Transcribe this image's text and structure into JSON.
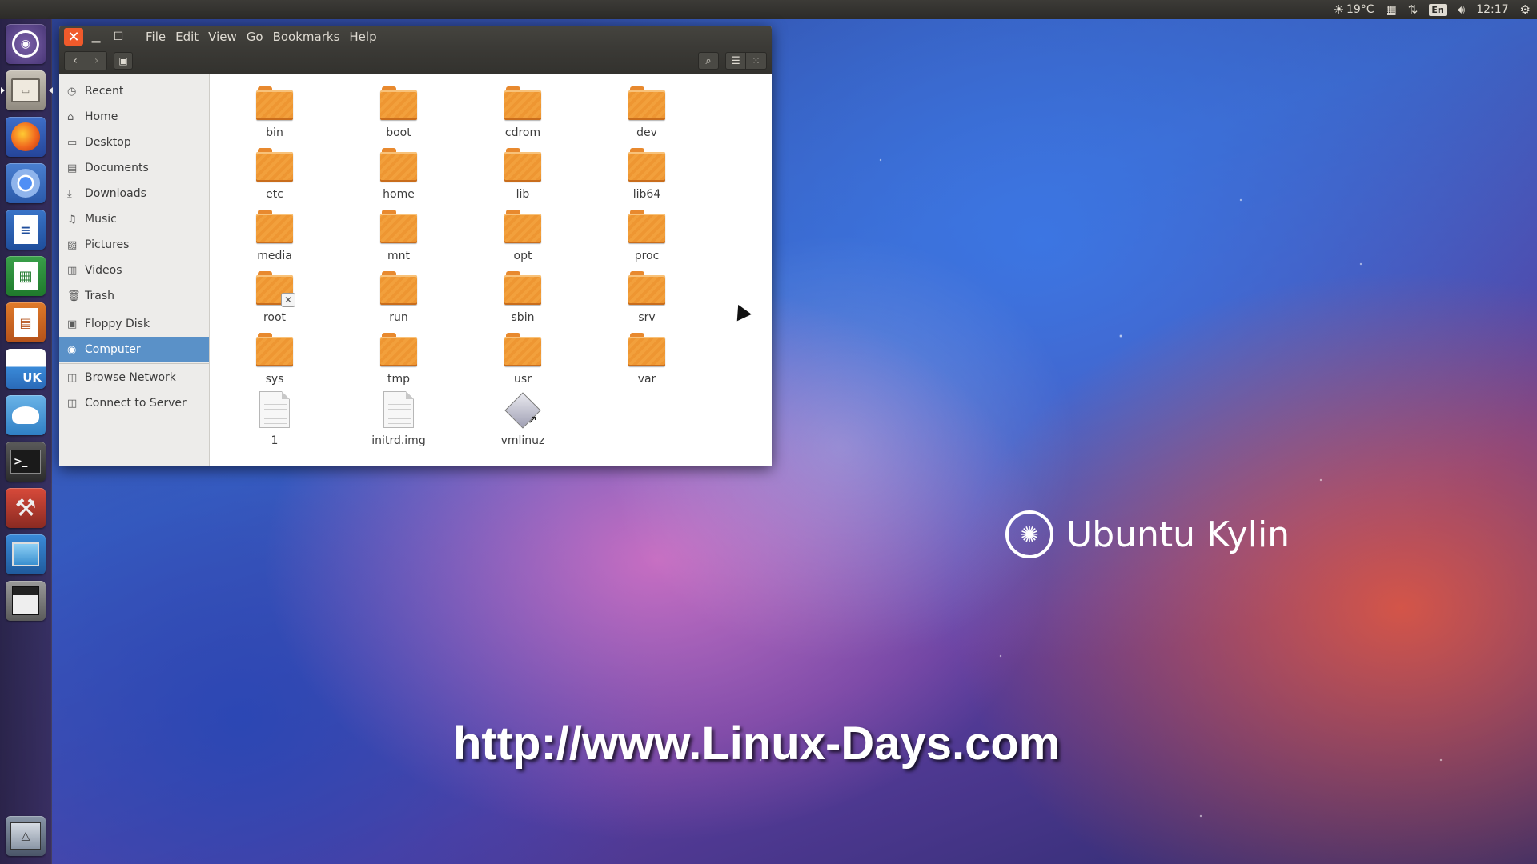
{
  "top_panel": {
    "weather": "19°C",
    "keyboard_layout": "En",
    "clock": "12:17",
    "icons": [
      "weather-icon",
      "calendar-icon",
      "network-icon",
      "keyboard-icon",
      "volume-icon",
      "gear-icon"
    ]
  },
  "launcher": {
    "items": [
      {
        "name": "dash-home",
        "icon": "ubuntu-logo-icon"
      },
      {
        "name": "files",
        "icon": "file-manager-icon",
        "running": true,
        "active": true
      },
      {
        "name": "firefox",
        "icon": "firefox-icon"
      },
      {
        "name": "chromium",
        "icon": "chromium-icon"
      },
      {
        "name": "writer",
        "icon": "libreoffice-writer-icon"
      },
      {
        "name": "calc",
        "icon": "libreoffice-calc-icon"
      },
      {
        "name": "impress",
        "icon": "libreoffice-impress-icon"
      },
      {
        "name": "kylin-software-center",
        "icon": "ubuntu-kylin-store-icon",
        "label": "UK"
      },
      {
        "name": "youker-assistant",
        "icon": "assistant-icon"
      },
      {
        "name": "terminal",
        "icon": "terminal-icon"
      },
      {
        "name": "system-settings",
        "icon": "settings-icon"
      },
      {
        "name": "desktop-viewer",
        "icon": "monitor-icon"
      },
      {
        "name": "floppy",
        "icon": "floppy-icon"
      },
      {
        "name": "trash",
        "icon": "trash-icon"
      }
    ]
  },
  "window": {
    "menu": [
      "File",
      "Edit",
      "View",
      "Go",
      "Bookmarks",
      "Help"
    ],
    "sidebar": {
      "places": [
        "Recent",
        "Home",
        "Desktop",
        "Documents",
        "Downloads",
        "Music",
        "Pictures",
        "Videos",
        "Trash"
      ],
      "devices": [
        "Floppy Disk",
        "Computer"
      ],
      "network": [
        "Browse Network",
        "Connect to Server"
      ],
      "selected": "Computer"
    },
    "files": [
      {
        "name": "bin",
        "type": "folder"
      },
      {
        "name": "boot",
        "type": "folder"
      },
      {
        "name": "cdrom",
        "type": "folder"
      },
      {
        "name": "dev",
        "type": "folder"
      },
      {
        "name": "etc",
        "type": "folder"
      },
      {
        "name": "home",
        "type": "folder"
      },
      {
        "name": "lib",
        "type": "folder"
      },
      {
        "name": "lib64",
        "type": "folder"
      },
      {
        "name": "media",
        "type": "folder"
      },
      {
        "name": "mnt",
        "type": "folder"
      },
      {
        "name": "opt",
        "type": "folder"
      },
      {
        "name": "proc",
        "type": "folder"
      },
      {
        "name": "root",
        "type": "folder-locked"
      },
      {
        "name": "run",
        "type": "folder"
      },
      {
        "name": "sbin",
        "type": "folder"
      },
      {
        "name": "srv",
        "type": "folder"
      },
      {
        "name": "sys",
        "type": "folder"
      },
      {
        "name": "tmp",
        "type": "folder"
      },
      {
        "name": "usr",
        "type": "folder"
      },
      {
        "name": "var",
        "type": "folder"
      },
      {
        "name": "1",
        "type": "document"
      },
      {
        "name": "initrd.img",
        "type": "document"
      },
      {
        "name": "vmlinuz",
        "type": "symlink-binary"
      }
    ]
  },
  "desktop": {
    "brand": "Ubuntu Kylin",
    "watermark": "http://www.Linux-Days.com"
  },
  "colors": {
    "close_button": "#f05a2b",
    "selection": "#5a91c8",
    "folder": "#f2a03c"
  }
}
